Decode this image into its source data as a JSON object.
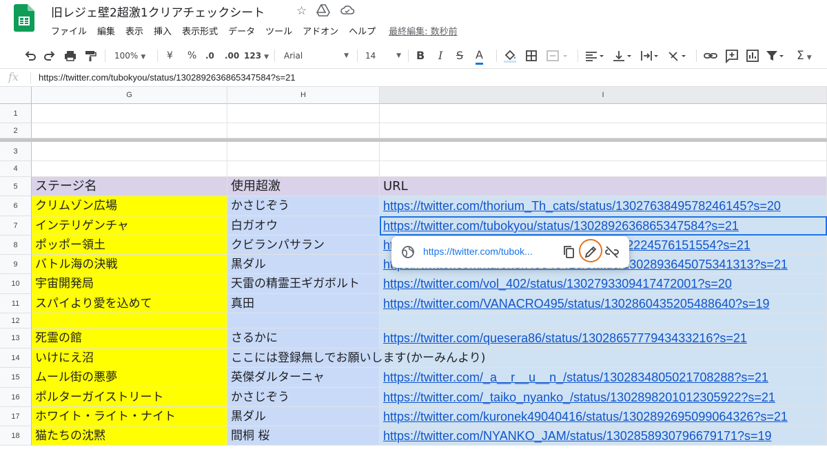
{
  "doc": {
    "title": "旧レジェ壁2超激1クリアチェックシート",
    "last_edit": "最終編集: 数秒前"
  },
  "menu": [
    "ファイル",
    "編集",
    "表示",
    "挿入",
    "表示形式",
    "データ",
    "ツール",
    "アドオン",
    "ヘルプ"
  ],
  "toolbar": {
    "zoom": "100%",
    "currency": "¥",
    "percent": "%",
    "dec_decrease": ".0",
    "dec_increase": ".00",
    "format_more": "123",
    "font": "Arial",
    "font_size": "14",
    "bold": "B",
    "italic": "I",
    "strike": "S",
    "text_color_letter": "A",
    "text_color": "#1a73e8",
    "sum": "Σ"
  },
  "formula_bar": {
    "fx": "fx",
    "value": "https://twitter.com/tubokyou/status/1302892636865347584?s=21"
  },
  "columns": [
    "G",
    "H",
    "I"
  ],
  "rows": [
    {
      "n": "1",
      "g": "",
      "h": "",
      "i": ""
    },
    {
      "n": "2",
      "g": "",
      "h": "",
      "i": ""
    },
    {
      "n": "3",
      "g": "",
      "h": "",
      "i": ""
    },
    {
      "n": "4",
      "g": "",
      "h": "",
      "i": ""
    },
    {
      "n": "5",
      "g": "ステージ名",
      "h": "使用超激",
      "i": "URL"
    },
    {
      "n": "6",
      "g": "クリムゾン広場",
      "h": "かさじぞう",
      "i": "https://twitter.com/thorium_Th_cats/status/1302763849578246145?s=20"
    },
    {
      "n": "7",
      "g": "インテリゲンチャ",
      "h": "白ガオウ",
      "i": "https://twitter.com/tubokyou/status/1302892636865347584?s=21"
    },
    {
      "n": "8",
      "g": "ポッポー領土",
      "h": "クビランパサラン",
      "i": "https://twitter.com/keroteeeee/status/1302872224576151554?s=21"
    },
    {
      "n": "9",
      "g": "バトル海の決戦",
      "h": "黒ダル",
      "i": "https://twitter.com/kuronek49040416/status/1302893645075341313?s=21"
    },
    {
      "n": "10",
      "g": "宇宙開発局",
      "h": "天雷の精霊王ギガボルト",
      "i": "https://twitter.com/vol_402/status/1302793309417472001?s=20"
    },
    {
      "n": "11",
      "g": "スパイより愛を込めて",
      "h": "真田",
      "i": "https://twitter.com/VANACRO495/status/1302860435205488640?s=19"
    },
    {
      "n": "12",
      "g": "",
      "h": "",
      "i": ""
    },
    {
      "n": "13",
      "g": "死霊の館",
      "h": "さるかに",
      "i": "https://twitter.com/quesera86/status/1302865777943433216?s=21"
    },
    {
      "n": "14",
      "g": "いけにえ沼",
      "h": "ここには登録無しでお願いします(かーみんより)",
      "i": ""
    },
    {
      "n": "15",
      "g": "ムール街の悪夢",
      "h": "英傑ダルターニャ",
      "i": "https://twitter.com/_a__r__u__n_/status/1302834805021708288?s=21"
    },
    {
      "n": "16",
      "g": "ポルターガイストリート",
      "h": "かさじぞう",
      "i": "https://twitter.com/_taiko_nyanko_/status/1302898201012305922?s=21"
    },
    {
      "n": "17",
      "g": "ホワイト・ライト・ナイト",
      "h": "黒ダル",
      "i": "https://twitter.com/kuronek49040416/status/1302892695099064326?s=21"
    },
    {
      "n": "18",
      "g": "猫たちの沈黙",
      "h": "間桐 桜",
      "i": "https://twitter.com/NYANKO_JAM/status/1302858930796679171?s=19"
    }
  ],
  "colors": {
    "header_row": "#d9d2e9",
    "stage_col": "#ffff00",
    "h_col": "#c9daf8",
    "i_col": "#cfe2f3",
    "selection": "#1a73e8",
    "annotation": "#e8711c"
  },
  "link_popup": {
    "url": "https://twitter.com/tubok..."
  }
}
